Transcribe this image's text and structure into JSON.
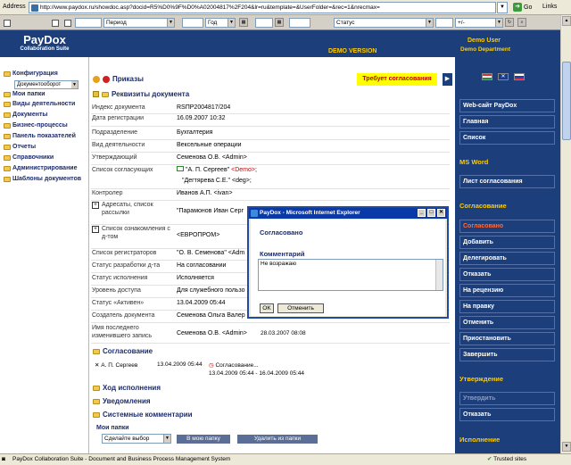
{
  "browser": {
    "address_label": "Address",
    "url": "http://www.paydox.ru/showdoc.asp?docid=R5%D0%9F%D0%A02004817%2F204&lr=ru&template=&UserFolder=&rec=1&nrecmax=",
    "go_label": "Go",
    "links_label": "Links"
  },
  "filterbar": {
    "period_label": "Период",
    "year_label": "Год",
    "status_label": "Статус",
    "plusminus_label": "+/-"
  },
  "header": {
    "logo_title": "PayDox",
    "logo_subtitle": "Collaboration Suite",
    "demo_version": "DEMO VERSION",
    "user_name": "Demo User",
    "department": "Demo Department"
  },
  "leftnav": {
    "config_label": "Конфигурация",
    "workflow_select": "Документооборот",
    "items": [
      {
        "label": "Мои папки"
      },
      {
        "label": "Виды деятельности"
      },
      {
        "label": "Документы"
      },
      {
        "label": "Бизнес-процессы"
      },
      {
        "label": "Панель показателей"
      },
      {
        "label": "Отчеты"
      },
      {
        "label": "Справочники"
      },
      {
        "label": "Администрирование"
      },
      {
        "label": "Шаблоны документов"
      }
    ]
  },
  "main": {
    "orders_title": "Приказы",
    "approval_badge": "Требует согласования",
    "requisites_title": "Реквизиты документа",
    "fields": [
      {
        "key": "Индекс документа",
        "value": "RSПР2004817/204"
      },
      {
        "key": "Дата регистрации",
        "value": "16.09.2007 10:32"
      },
      {
        "key": "Подразделение",
        "value": "Бухгалтерия"
      },
      {
        "key": "Вид деятельности",
        "value": "Вексельные операции"
      },
      {
        "key": "Утверждающий",
        "value": "Семенова О.В. <Admin>"
      },
      {
        "key": "Список согласующих",
        "value": "\"А. П. Сергеев\"",
        "value_red": "<Demo>",
        "value2": "\"Дегтярева С.Е.\" <deg>;"
      },
      {
        "key": "Контролер",
        "value": "Иванов А.П. <ivan>"
      },
      {
        "key": "Адресаты, список рассылки",
        "value": "\"Парамонов Иван Серг"
      },
      {
        "key": "Список ознакомления с д-том",
        "value": "<ЕВРОПРОМ>"
      },
      {
        "key": "Список регистраторов",
        "value": "\"О. В. Семенова\" <Adm"
      },
      {
        "key": "Статус разработки д-та",
        "value": "На согласовании"
      },
      {
        "key": "Статус исполнения",
        "value": "Исполняется"
      },
      {
        "key": "Уровень доступа",
        "value": "Для служебного пользо"
      },
      {
        "key": "Статус «Активен»",
        "value": "13.04.2009 05:44"
      },
      {
        "key": "Создатель документа",
        "value": "Семенова Ольга Валер"
      },
      {
        "key": "Имя последнего изменившего запись",
        "value": "Семенова О.В. <Admin>",
        "value_date": "28.03.2007 08:08"
      }
    ],
    "approval_section": "Согласование",
    "approval_row": {
      "person": "А. П. Сергеев",
      "date": "13.04.2009 05:44",
      "action": "Согласование...",
      "range": "13.04.2009 05:44 - 16.04.2009 05:44"
    },
    "progress_section": "Ход исполнения",
    "notifications_section": "Уведомления",
    "system_comments_section": "Системные комментарии",
    "my_folders_title": "Мои папки",
    "choose_select": "Сделайте выбор",
    "to_folder_button": "В мою папку",
    "remove_folder_button": "Удалить из папки"
  },
  "rightpanel": {
    "buttons_top": [
      {
        "label": "Web-сайт PayDox"
      },
      {
        "label": "Главная"
      },
      {
        "label": "Список"
      }
    ],
    "msword_header": "MS Word",
    "approval_sheet": "Лист согласования",
    "approval_header": "Согласование",
    "approval_buttons": [
      {
        "label": "Согласовано"
      },
      {
        "label": "Добавить"
      },
      {
        "label": "Делегировать"
      },
      {
        "label": "Отказать"
      },
      {
        "label": "На рецензию"
      },
      {
        "label": "На правку"
      },
      {
        "label": "Отменить"
      },
      {
        "label": "Приостановить"
      },
      {
        "label": "Завершить"
      }
    ],
    "approve_header": "Утверждение",
    "approve_buttons": [
      {
        "label": "Утвердить"
      },
      {
        "label": "Отказать"
      }
    ],
    "execution_header": "Исполнение"
  },
  "dialog": {
    "title": "PayDox - Microsoft Internet Explorer",
    "heading": "Согласовано",
    "comment_label": "Комментарий",
    "comment_text": "Не возражаю",
    "ok_label": "OK",
    "cancel_label": "Отменить"
  },
  "statusbar": {
    "text": "PayDox Collaboration Suite - Document and Business Process Management System",
    "zone": "Trusted sites"
  },
  "colors": {
    "brand_navy": "#1c3e7a",
    "accent_yellow": "#ffcc00",
    "badge_red": "#c00000"
  }
}
